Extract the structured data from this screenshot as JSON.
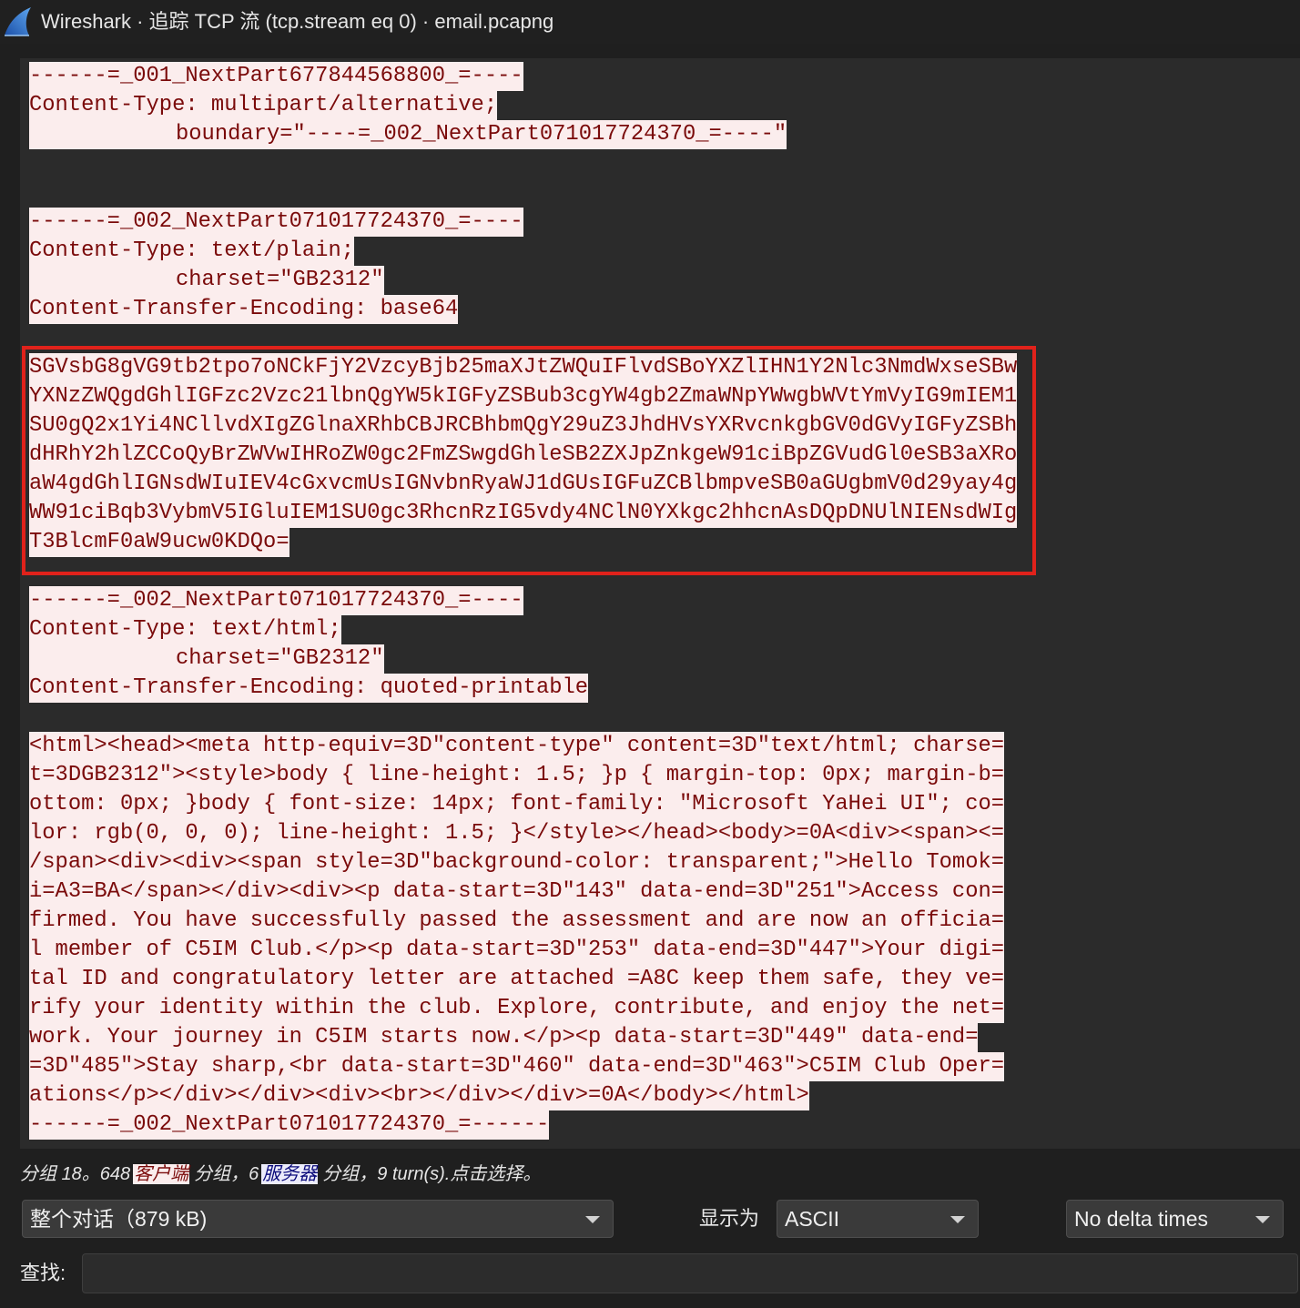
{
  "window": {
    "icon": "wireshark-fin-icon",
    "title": "Wireshark · 追踪 TCP 流 (tcp.stream eq 0) · email.pcapng"
  },
  "colors": {
    "client_fg": "#7a0a0a",
    "client_bg": "#fbeded",
    "server_fg": "#0a0a7a",
    "server_bg": "#ececfb",
    "annotation_box": "#e0221b"
  },
  "stream": {
    "groups": [
      {
        "boxed": false,
        "lines": [
          "------=_001_NextPart677844568800_=----",
          "Content-Type: multipart/alternative;",
          "\tboundary=\"----=_002_NextPart071017724370_=----\"",
          "",
          "",
          "------=_002_NextPart071017724370_=----",
          "Content-Type: text/plain;",
          "\tcharset=\"GB2312\"",
          "Content-Transfer-Encoding: base64",
          ""
        ]
      },
      {
        "boxed": true,
        "lines": [
          "SGVsbG8gVG9tb2tpo7oNCkFjY2VzcyBjb25maXJtZWQuIFlvdSBoYXZlIHN1Y2Nlc3NmdWxseSBw",
          "YXNzZWQgdGhlIGFzc2Vzc21lbnQgYW5kIGFyZSBub3cgYW4gb2ZmaWNpYWwgbWVtYmVyIG9mIEM1",
          "SU0gQ2x1Yi4NCllvdXIgZGlnaXRhbCBJRCBhbmQgY29uZ3JhdHVsYXRvcnkgbGV0dGVyIGFyZSBh",
          "dHRhY2hlZCCoQyBrZWVwIHRoZW0gc2FmZSwgdGhleSB2ZXJpZnkgeW91ciBpZGVudGl0eSB3aXRo",
          "aW4gdGhlIGNsdWIuIEV4cGxvcmUsIGNvbnRyaWJ1dGUsIGFuZCBlbmpveSB0aGUgbmV0d29yay4g",
          "WW91ciBqb3VybmV5IGluIEM1SU0gc3RhcnRzIG5vdy4NClN0YXkgc2hhcnAsDQpDNUlNIENsdWIg",
          "T3BlcmF0aW9ucw0KDQo="
        ]
      },
      {
        "boxed": false,
        "lines": [
          "",
          "------=_002_NextPart071017724370_=----",
          "Content-Type: text/html;",
          "\tcharset=\"GB2312\"",
          "Content-Transfer-Encoding: quoted-printable",
          "",
          "<html><head><meta http-equiv=3D\"content-type\" content=3D\"text/html; charse=",
          "t=3DGB2312\"><style>body { line-height: 1.5; }p { margin-top: 0px; margin-b=",
          "ottom: 0px; }body { font-size: 14px; font-family: \"Microsoft YaHei UI\"; co=",
          "lor: rgb(0, 0, 0); line-height: 1.5; }</style></head><body>=0A<div><span><=",
          "/span><div><div><span style=3D\"background-color: transparent;\">Hello Tomok=",
          "i=A3=BA</span></div><div><p data-start=3D\"143\" data-end=3D\"251\">Access con=",
          "firmed. You have successfully passed the assessment and are now an officia=",
          "l member of C5IM Club.</p><p data-start=3D\"253\" data-end=3D\"447\">Your digi=",
          "tal ID and congratulatory letter are attached =A8C keep them safe, they ve=",
          "rify your identity within the club. Explore, contribute, and enjoy the net=",
          "work. Your journey in C5IM starts now.</p><p data-start=3D\"449\" data-end=",
          "=3D\"485\">Stay sharp,<br data-start=3D\"460\" data-end=3D\"463\">C5IM Club Oper=",
          "ations</p></div></div><div><br></div></div>=0A</body></html>",
          "------=_002_NextPart071017724370_=------"
        ]
      }
    ]
  },
  "status": {
    "prefix": "分组 18。648",
    "client_label": "客户端",
    "middle": "分组，6",
    "server_label": "服务器",
    "suffix": "分组，9 turn(s).点击选择。"
  },
  "controls": {
    "conversation_select": {
      "value": "整个对话（879 kB)",
      "icon": "chevron-down-icon"
    },
    "show_as_label": "显示为",
    "show_as_select": {
      "value": "ASCII",
      "icon": "chevron-down-icon"
    },
    "delta_select": {
      "value": "No delta times",
      "icon": "chevron-down-icon"
    },
    "find_label": "查找:",
    "find_value": ""
  }
}
